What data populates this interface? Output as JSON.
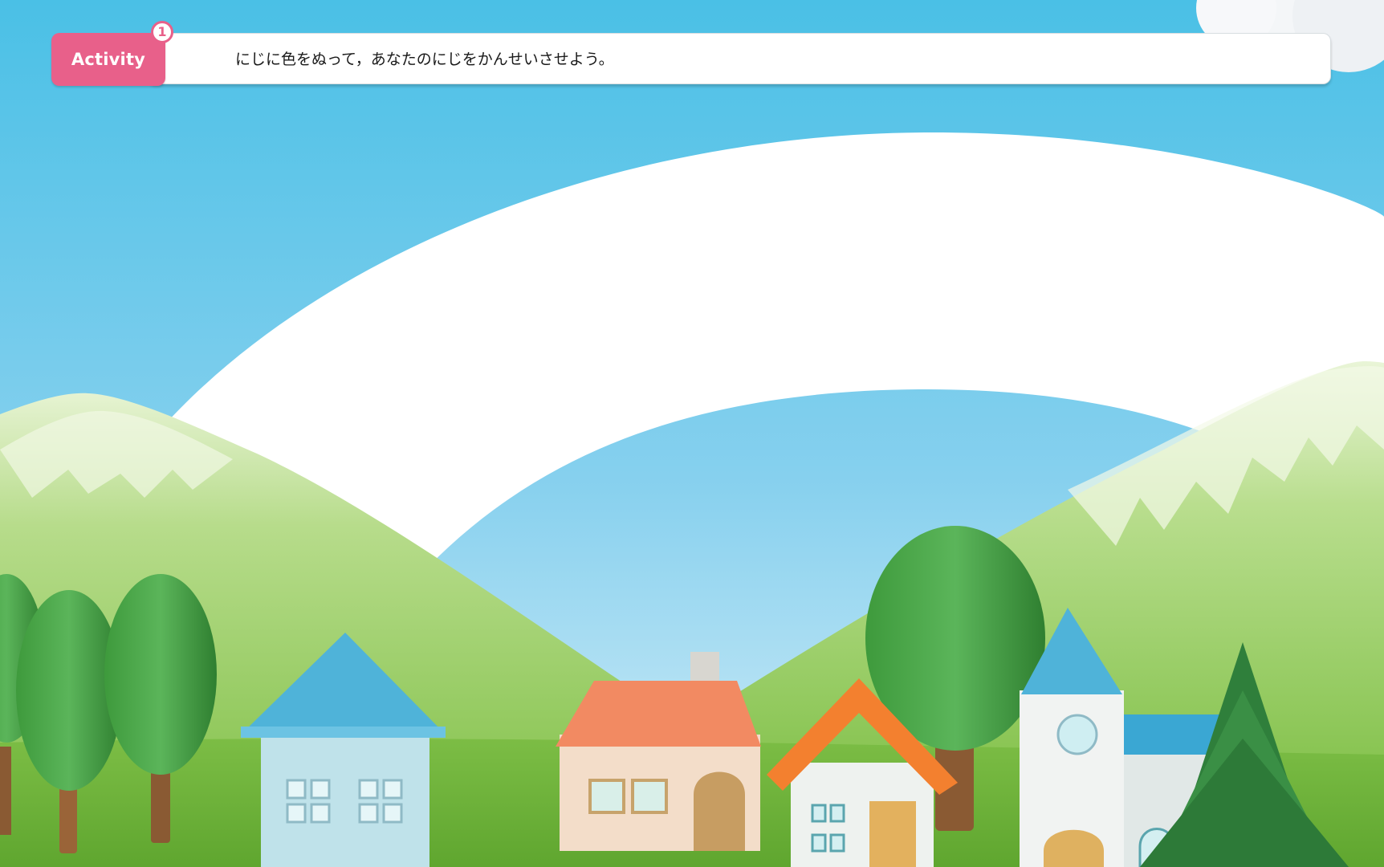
{
  "activity": {
    "tag_label": "Activity",
    "number": "1",
    "instruction": "にじに色をぬって，あなたのにじをかんせいさせよう。"
  },
  "colors": {
    "tag": "#e8608a",
    "sky_top": "#4ac0e6",
    "sky_bottom": "#d6eef8",
    "rainbow": "#ffffff",
    "hill": "#a6d370",
    "grass": "#6fb43a"
  }
}
